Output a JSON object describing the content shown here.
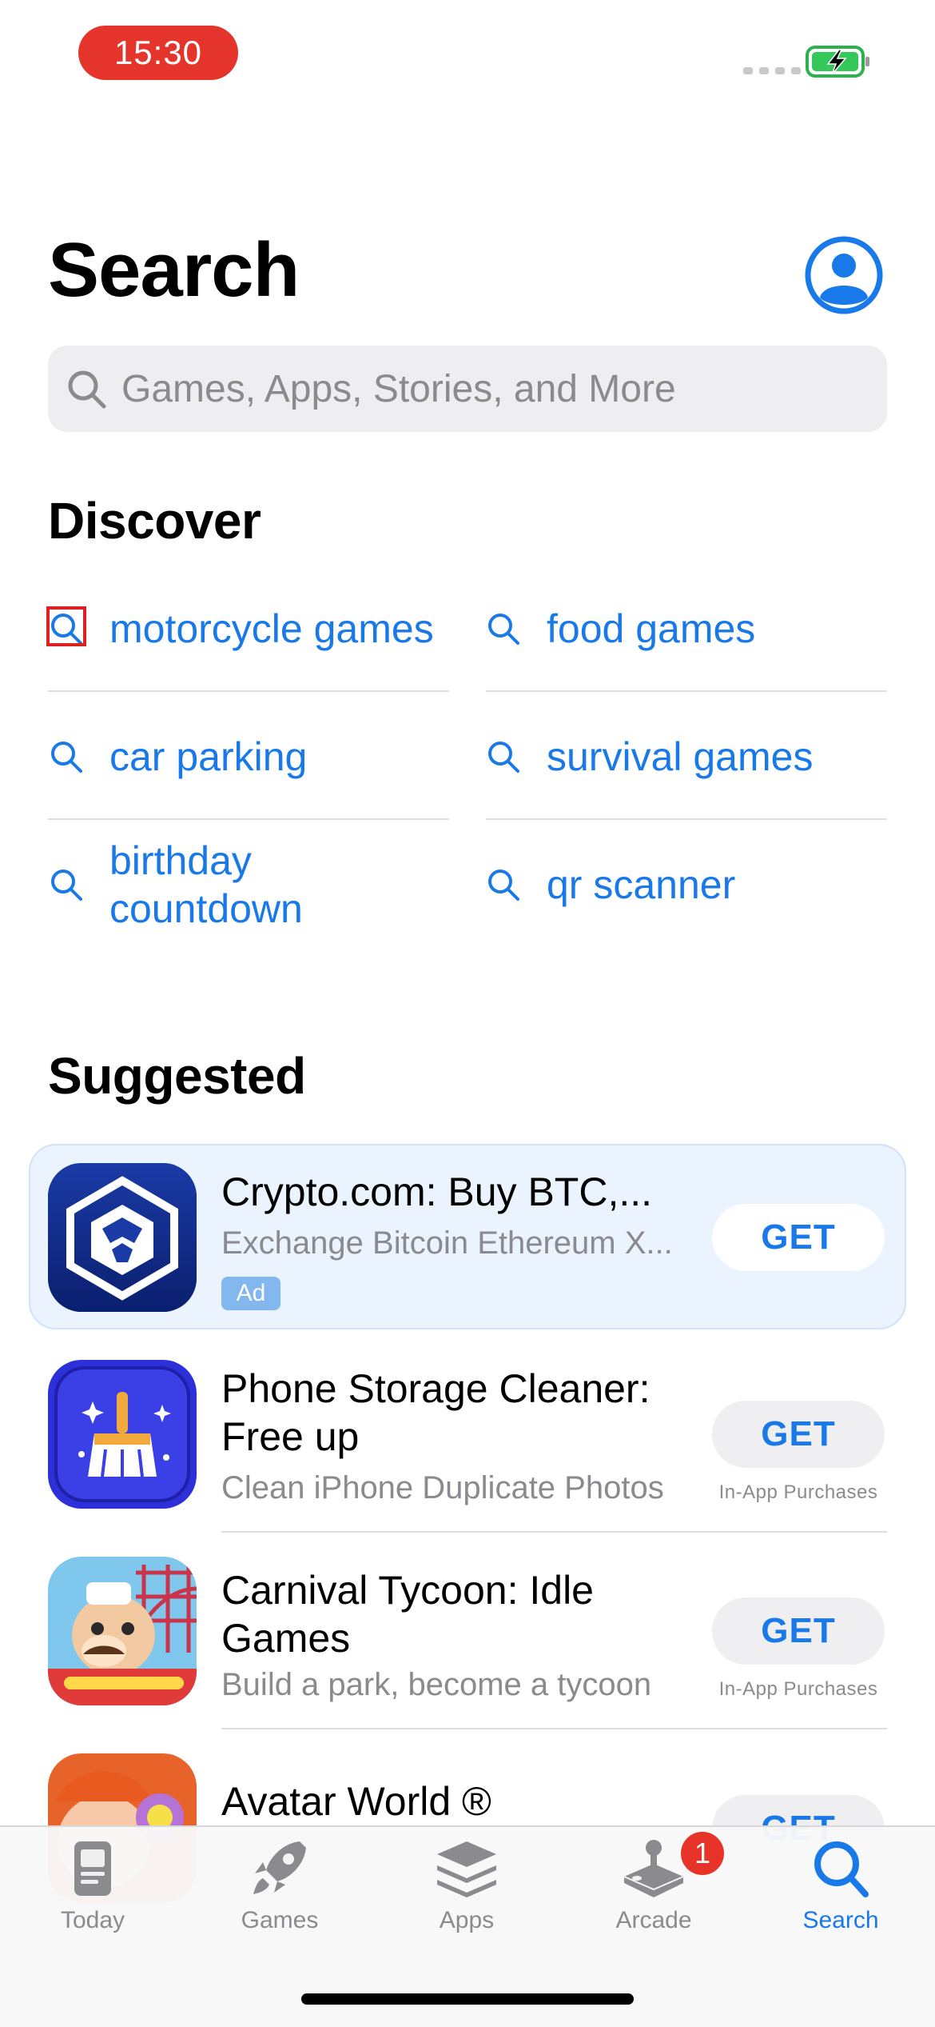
{
  "status_bar": {
    "time": "15:30"
  },
  "header": {
    "title": "Search"
  },
  "search": {
    "placeholder": "Games, Apps, Stories, and More"
  },
  "discover": {
    "heading": "Discover",
    "items": [
      "motorcycle games",
      "food games",
      "car parking",
      "survival games",
      "birthday countdown",
      "qr scanner"
    ],
    "icon": "magnifier-icon"
  },
  "suggested": {
    "heading": "Suggested",
    "apps": [
      {
        "name": "Crypto.com: Buy BTC,...",
        "subtitle": "Exchange Bitcoin Ethereum X...",
        "badge": "Ad",
        "button": "GET",
        "note": ""
      },
      {
        "name": "Phone Storage Cleaner: Free up",
        "subtitle": "Clean iPhone Duplicate Photos",
        "button": "GET",
        "note": "In-App Purchases"
      },
      {
        "name": "Carnival Tycoon: Idle Games",
        "subtitle": "Build a park, become a tycoon",
        "button": "GET",
        "note": "In-App Purchases"
      },
      {
        "name": "Avatar World ®",
        "subtitle": "",
        "button": "GET",
        "note": ""
      }
    ]
  },
  "tabs": [
    {
      "label": "Today",
      "icon": "today-icon"
    },
    {
      "label": "Games",
      "icon": "rocket-icon"
    },
    {
      "label": "Apps",
      "icon": "layers-icon"
    },
    {
      "label": "Arcade",
      "icon": "joystick-icon",
      "badge": "1"
    },
    {
      "label": "Search",
      "icon": "search-icon",
      "active": true
    }
  ],
  "colors": {
    "accent": "#1979e8",
    "ad_background": "#eaf3fe",
    "badge": "#e8332a",
    "time_pill": "#e5342c"
  }
}
